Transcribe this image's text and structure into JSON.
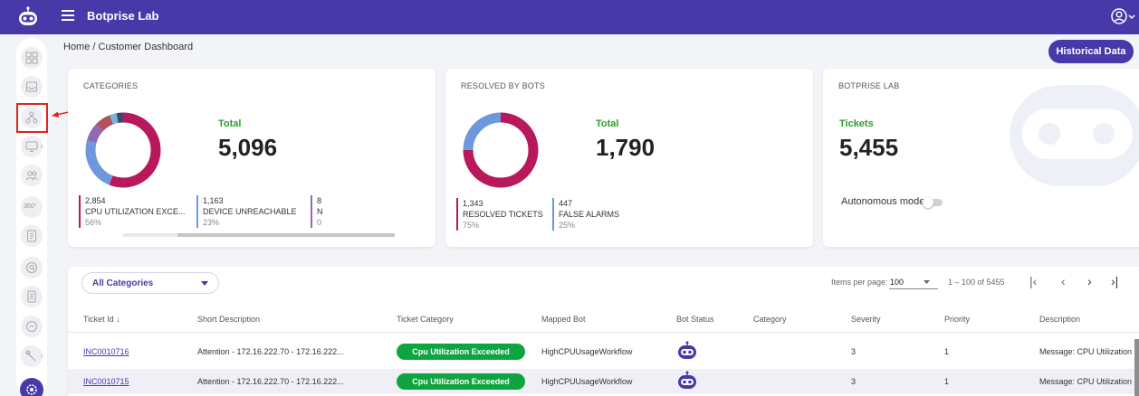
{
  "app": {
    "title": "Botprise Lab"
  },
  "colors": {
    "brand": "#473aa8",
    "crimson": "#b7195c",
    "blue": "#6d98dd",
    "green": "#0ea540",
    "highlight": "#e0241b"
  },
  "breadcrumb": "Home / Customer Dashboard",
  "header": {
    "historical_label": "Historical Data"
  },
  "sidebar": {
    "items": [
      "dashboard-icon",
      "inbox-icon",
      "hierarchy-icon",
      "monitor-icon",
      "users-icon",
      "360-icon",
      "document-icon",
      "search-icon",
      "file-icon",
      "chat-icon",
      "tools-icon",
      "settings-icon"
    ],
    "item_360_label": "360°"
  },
  "categories_card": {
    "title": "CATEGORIES",
    "total_label": "Total",
    "total_value": "5,096",
    "stats": [
      {
        "num": "2,854",
        "label": "CPU UTILIZATION EXCE...",
        "pct": "56%"
      },
      {
        "num": "1,163",
        "label": "DEVICE UNREACHABLE",
        "pct": "23%"
      },
      {
        "num": "8",
        "label": "N",
        "pct": "0"
      }
    ],
    "donut": [
      56,
      23,
      8,
      7,
      3,
      3
    ]
  },
  "resolved_card": {
    "title": "RESOLVED BY BOTS",
    "total_label": "Total",
    "total_value": "1,790",
    "stats": [
      {
        "num": "1,343",
        "label": "RESOLVED TICKETS",
        "pct": "75%"
      },
      {
        "num": "447",
        "label": "FALSE ALARMS",
        "pct": "25%"
      }
    ],
    "donut": [
      75,
      25
    ]
  },
  "lab_card": {
    "title": "BOTPRISE LAB",
    "tickets_label": "Tickets",
    "tickets_value": "5,455",
    "autonomous_label": "Autonomous mode",
    "autonomous_on": false
  },
  "filter": {
    "selected": "All Categories"
  },
  "pager": {
    "items_label": "Items per page:",
    "page_size": "100",
    "range": "1 – 100 of 5455"
  },
  "table": {
    "columns": [
      "Ticket Id",
      "Short Description",
      "Ticket Category",
      "Mapped Bot",
      "Bot Status",
      "Category",
      "Severity",
      "Priority",
      "Description"
    ],
    "rows": [
      {
        "ticket_id": "INC0010716",
        "short_desc": "Attention - 172.16.222.70 - 172.16.222...",
        "ticket_category": "Cpu Utilization Exceeded",
        "mapped_bot": "HighCPUUsageWorkflow",
        "category": "",
        "severity": "3",
        "priority": "1",
        "description": "Message: CPU Utilization i"
      },
      {
        "ticket_id": "INC0010715",
        "short_desc": "Attention - 172.16.222.70 - 172.16.222...",
        "ticket_category": "Cpu Utilization Exceeded",
        "mapped_bot": "HighCPUUsageWorkflow",
        "category": "",
        "severity": "3",
        "priority": "1",
        "description": "Message: CPU Utilization i"
      }
    ]
  }
}
